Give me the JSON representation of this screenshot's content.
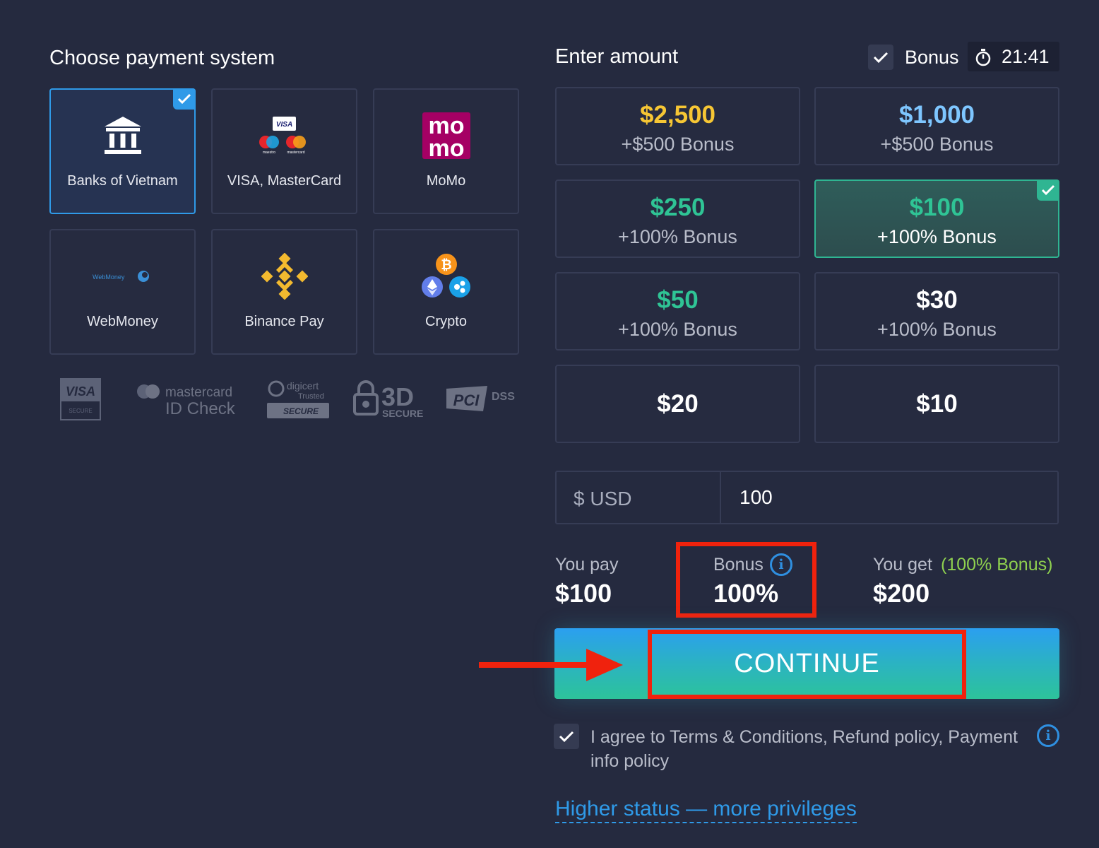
{
  "payment": {
    "title": "Choose payment system",
    "methods": [
      {
        "label": "Banks of Vietnam",
        "selected": true
      },
      {
        "label": "VISA, MasterCard",
        "selected": false
      },
      {
        "label": "MoMo",
        "selected": false
      },
      {
        "label": "WebMoney",
        "selected": false
      },
      {
        "label": "Binance Pay",
        "selected": false
      },
      {
        "label": "Crypto",
        "selected": false
      }
    ],
    "logo_texts": {
      "visa_small": "VISA",
      "maestro": "maestro",
      "mastercard_small": "mastercard",
      "momo_top": "mo",
      "momo_bottom": "mo",
      "webmoney": "WebMoney",
      "bitcoin": "₿"
    },
    "trust_badges": {
      "visa": "VISA",
      "visa_sub": "SECURE",
      "mc_line1": "mastercard",
      "mc_line2": "ID Check",
      "digicert_1": "digicert",
      "digicert_2": "Trusted",
      "digicert_3": "SECURE",
      "secure3d_1": "3D",
      "secure3d_2": "SECURE",
      "pci_1": "PCI",
      "pci_2": "DSS"
    }
  },
  "amount": {
    "title": "Enter amount",
    "bonus_label": "Bonus",
    "bonus_checked": true,
    "timer": "21:41",
    "options": [
      {
        "amount": "$2,500",
        "bonus": "+$500 Bonus",
        "color": "#f6c634"
      },
      {
        "amount": "$1,000",
        "bonus": "+$500 Bonus",
        "color": "#7ec6ff"
      },
      {
        "amount": "$250",
        "bonus": "+100% Bonus",
        "color": "#2fc495"
      },
      {
        "amount": "$100",
        "bonus": "+100% Bonus",
        "color": "#2fc495",
        "selected": true
      },
      {
        "amount": "$50",
        "bonus": "+100% Bonus",
        "color": "#2fc495"
      },
      {
        "amount": "$30",
        "bonus": "+100% Bonus",
        "color": "#ffffff"
      },
      {
        "amount": "$20",
        "bonus": "",
        "color": "#ffffff"
      },
      {
        "amount": "$10",
        "bonus": "",
        "color": "#ffffff"
      }
    ],
    "currency": "$ USD",
    "value": "100"
  },
  "summary": {
    "pay_label": "You pay",
    "pay_value": "$100",
    "bonus_label": "Bonus",
    "bonus_value": "100%",
    "get_label": "You get",
    "get_note": "(100% Bonus)",
    "get_value": "$200"
  },
  "continue_label": "CONTINUE",
  "agreement": {
    "text": "I agree to Terms & Conditions, Refund policy, Payment info policy",
    "checked": true
  },
  "higher_status": "Higher status — more privileges",
  "colors": {
    "accent_blue": "#2f9ae8",
    "accent_green": "#2fc495",
    "highlight_red": "#f0220d",
    "gold": "#f6c634"
  }
}
